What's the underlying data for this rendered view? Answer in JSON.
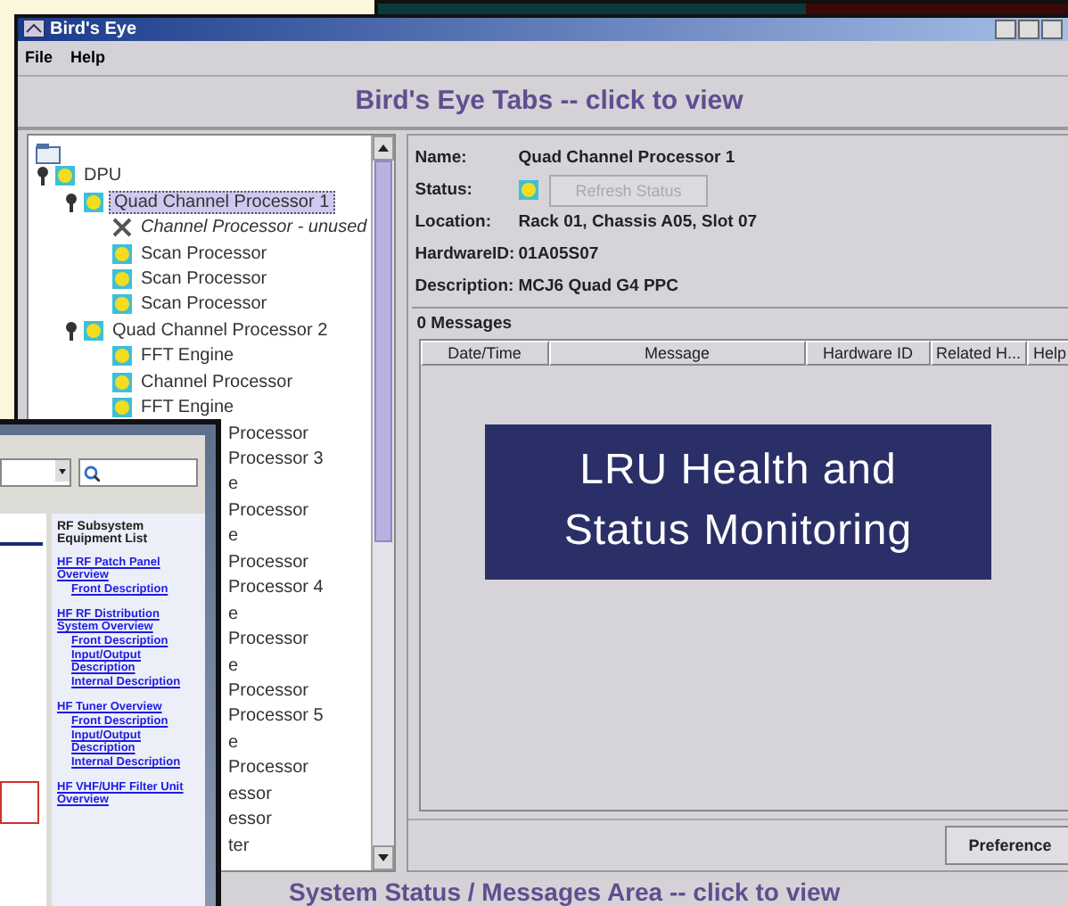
{
  "window": {
    "title": "Bird's Eye"
  },
  "menu": [
    "File",
    "Help"
  ],
  "tabs_header": "Bird's Eye Tabs -- click to view",
  "tree": [
    {
      "label": "DPU",
      "kind": "node",
      "expanded": true,
      "selected": false,
      "children": [
        {
          "label": "Quad Channel Processor 1",
          "kind": "node",
          "expanded": true,
          "selected": true,
          "children": [
            {
              "label": "Channel Processor - unused",
              "kind": "unused",
              "selected": false
            },
            {
              "label": "Scan Processor",
              "kind": "node",
              "selected": false
            },
            {
              "label": "Scan Processor",
              "kind": "node",
              "selected": false
            },
            {
              "label": "Scan Processor",
              "kind": "node",
              "selected": false
            }
          ]
        },
        {
          "label": "Quad Channel Processor 2",
          "kind": "node",
          "expanded": true,
          "selected": false,
          "children": [
            {
              "label": "FFT Engine",
              "kind": "node",
              "selected": false
            },
            {
              "label": "Channel Processor",
              "kind": "node",
              "selected": false
            },
            {
              "label": "FFT Engine",
              "kind": "node",
              "selected": false
            }
          ]
        }
      ]
    }
  ],
  "tree_fragments": [
    "Processor",
    "Processor 3",
    "e",
    "Processor",
    "e",
    "Processor",
    "Processor 4",
    "e",
    "Processor",
    "e",
    "Processor",
    "Processor 5",
    "e",
    "Processor",
    "essor",
    "essor",
    "ter"
  ],
  "details": {
    "rows": [
      {
        "label": "Name:",
        "value": "Quad Channel Processor 1"
      },
      {
        "label": "Status:",
        "kind": "status",
        "button": {
          "label": "Refresh Status",
          "disabled": true
        }
      },
      {
        "label": "Location:",
        "value": "Rack 01, Chassis A05, Slot 07"
      },
      {
        "label": "HardwareID:",
        "value": "01A05S07"
      },
      {
        "label": "Description:",
        "value": "MCJ6 Quad G4 PPC"
      }
    ],
    "messages_title": "0 Messages",
    "columns": [
      "Date/Time",
      "Message",
      "Hardware ID",
      "Related H...",
      "Help"
    ],
    "preference_button": "Preference"
  },
  "status_area": "System Status / Messages Area -- click to view",
  "caption": "LRU Health and Status Monitoring",
  "doc_window": {
    "heading": "RF Subsystem Equipment List",
    "links": [
      {
        "text": "HF RF Patch Panel Overview",
        "children": [
          {
            "text": "Front Description"
          }
        ]
      },
      {
        "text": "HF RF Distribution System Overview",
        "children": [
          {
            "text": "Front Description"
          },
          {
            "text": "Input/Output Description"
          },
          {
            "text": "Internal Description"
          }
        ]
      },
      {
        "text": "HF Tuner Overview",
        "children": [
          {
            "text": "Front Description"
          },
          {
            "text": "Input/Output Description"
          },
          {
            "text": "Internal Description"
          }
        ]
      },
      {
        "text": "HF VHF/UHF Filter Unit Overview"
      }
    ]
  }
}
